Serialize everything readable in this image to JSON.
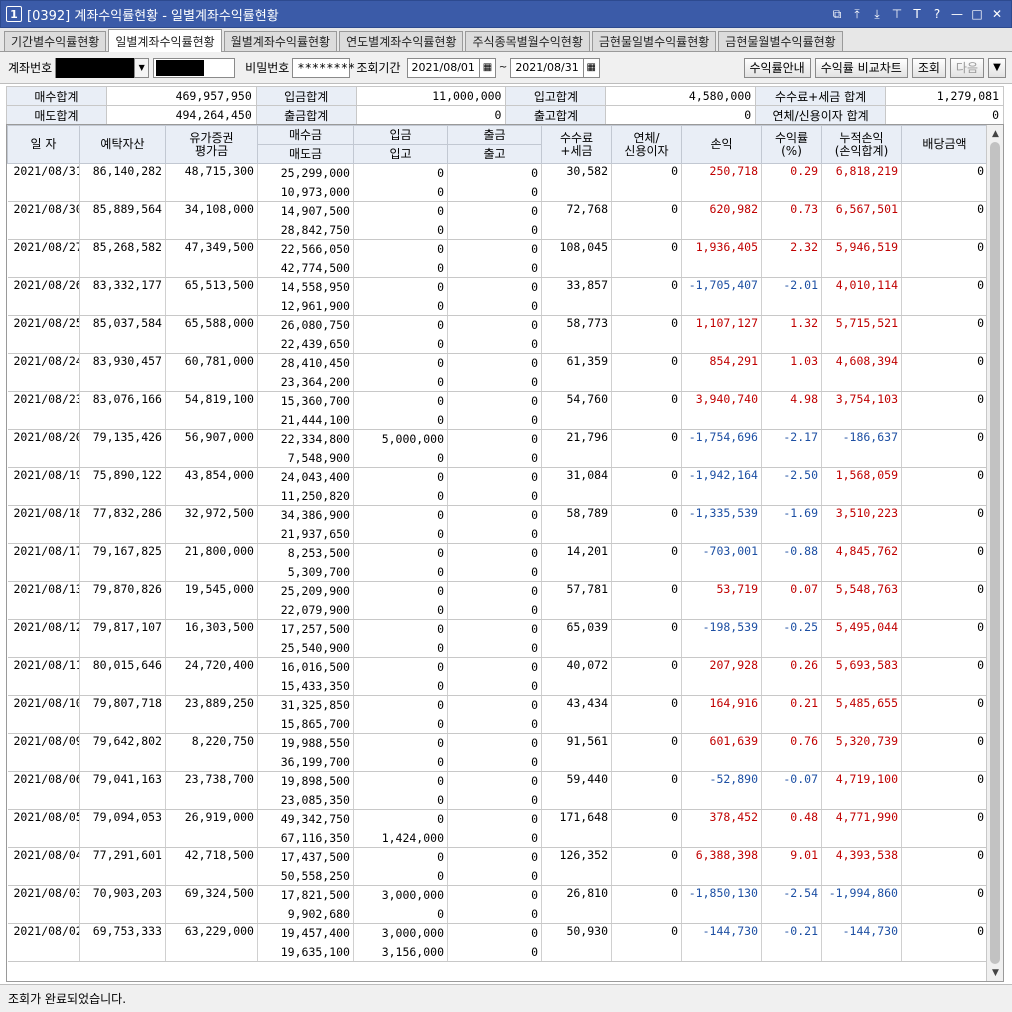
{
  "window": {
    "num": "1",
    "title": "[0392] 계좌수익률현황 - 일별계좌수익률현황",
    "controls": [
      "⧉",
      "⤒",
      "⤓",
      "⊤",
      "T",
      "?",
      "—",
      "□",
      "✕"
    ]
  },
  "tabs": [
    {
      "label": "기간별수익률현황",
      "active": false
    },
    {
      "label": "일별계좌수익률현황",
      "active": true
    },
    {
      "label": "월별계좌수익률현황",
      "active": false
    },
    {
      "label": "연도별계좌수익률현황",
      "active": false
    },
    {
      "label": "주식종목별월수익현황",
      "active": false
    },
    {
      "label": "금현물일별수익률현황",
      "active": false
    },
    {
      "label": "금현물월별수익률현황",
      "active": false
    }
  ],
  "toolbar": {
    "account_label": "계좌번호",
    "password_label": "비밀번호",
    "password_value": "********",
    "period_label": "조회기간",
    "date_from": "2021/08/01",
    "date_to": "2021/08/31",
    "tilde": "~",
    "btn_guide": "수익률안내",
    "btn_compare": "수익률 비교차트",
    "btn_query": "조회",
    "btn_next": "다음"
  },
  "summary": {
    "rows": [
      [
        {
          "h": "매수합계",
          "v": "469,957,950"
        },
        {
          "h": "입금합계",
          "v": "11,000,000"
        },
        {
          "h": "입고합계",
          "v": "4,580,000"
        },
        {
          "h": "수수료+세금 합계",
          "v": "1,279,081"
        }
      ],
      [
        {
          "h": "매도합계",
          "v": "494,264,450"
        },
        {
          "h": "출금합계",
          "v": "0"
        },
        {
          "h": "출고합계",
          "v": "0"
        },
        {
          "h": "연체/신용이자 합계",
          "v": "0"
        }
      ]
    ]
  },
  "grid": {
    "headers": {
      "date": "일 자",
      "deposit": "예탁자산",
      "securities": "유가증권\n평가금",
      "buy": "매수금",
      "sell": "매도금",
      "in_money": "입금",
      "in_stock": "입고",
      "out_money": "출금",
      "out_stock": "출고",
      "fee": "수수료\n+세금",
      "interest": "연체/\n신용이자",
      "pnl": "손익",
      "rate": "수익률\n(%)",
      "cum": "누적손익\n(손익합계)",
      "dividend": "배당금액"
    },
    "rows": [
      {
        "date": "2021/08/31",
        "deposit": "86,140,282",
        "sec": "48,715,300",
        "buy": "25,299,000",
        "sell": "10,973,000",
        "in1": "0",
        "in2": "0",
        "out1": "0",
        "out2": "0",
        "fee": "30,582",
        "int": "0",
        "pnl": "250,718",
        "rate": "0.29",
        "cum": "6,818,219",
        "div": "0"
      },
      {
        "date": "2021/08/30",
        "deposit": "85,889,564",
        "sec": "34,108,000",
        "buy": "14,907,500",
        "sell": "28,842,750",
        "in1": "0",
        "in2": "0",
        "out1": "0",
        "out2": "0",
        "fee": "72,768",
        "int": "0",
        "pnl": "620,982",
        "rate": "0.73",
        "cum": "6,567,501",
        "div": "0"
      },
      {
        "date": "2021/08/27",
        "deposit": "85,268,582",
        "sec": "47,349,500",
        "buy": "22,566,050",
        "sell": "42,774,500",
        "in1": "0",
        "in2": "0",
        "out1": "0",
        "out2": "0",
        "fee": "108,045",
        "int": "0",
        "pnl": "1,936,405",
        "rate": "2.32",
        "cum": "5,946,519",
        "div": "0"
      },
      {
        "date": "2021/08/26",
        "deposit": "83,332,177",
        "sec": "65,513,500",
        "buy": "14,558,950",
        "sell": "12,961,900",
        "in1": "0",
        "in2": "0",
        "out1": "0",
        "out2": "0",
        "fee": "33,857",
        "int": "0",
        "pnl": "-1,705,407",
        "rate": "-2.01",
        "cum": "4,010,114",
        "div": "0"
      },
      {
        "date": "2021/08/25",
        "deposit": "85,037,584",
        "sec": "65,588,000",
        "buy": "26,080,750",
        "sell": "22,439,650",
        "in1": "0",
        "in2": "0",
        "out1": "0",
        "out2": "0",
        "fee": "58,773",
        "int": "0",
        "pnl": "1,107,127",
        "rate": "1.32",
        "cum": "5,715,521",
        "div": "0"
      },
      {
        "date": "2021/08/24",
        "deposit": "83,930,457",
        "sec": "60,781,000",
        "buy": "28,410,450",
        "sell": "23,364,200",
        "in1": "0",
        "in2": "0",
        "out1": "0",
        "out2": "0",
        "fee": "61,359",
        "int": "0",
        "pnl": "854,291",
        "rate": "1.03",
        "cum": "4,608,394",
        "div": "0"
      },
      {
        "date": "2021/08/23",
        "deposit": "83,076,166",
        "sec": "54,819,100",
        "buy": "15,360,700",
        "sell": "21,444,100",
        "in1": "0",
        "in2": "0",
        "out1": "0",
        "out2": "0",
        "fee": "54,760",
        "int": "0",
        "pnl": "3,940,740",
        "rate": "4.98",
        "cum": "3,754,103",
        "div": "0"
      },
      {
        "date": "2021/08/20",
        "deposit": "79,135,426",
        "sec": "56,907,000",
        "buy": "22,334,800",
        "sell": "7,548,900",
        "in1": "5,000,000",
        "in2": "0",
        "out1": "0",
        "out2": "0",
        "fee": "21,796",
        "int": "0",
        "pnl": "-1,754,696",
        "rate": "-2.17",
        "cum": "-186,637",
        "div": "0"
      },
      {
        "date": "2021/08/19",
        "deposit": "75,890,122",
        "sec": "43,854,000",
        "buy": "24,043,400",
        "sell": "11,250,820",
        "in1": "0",
        "in2": "0",
        "out1": "0",
        "out2": "0",
        "fee": "31,084",
        "int": "0",
        "pnl": "-1,942,164",
        "rate": "-2.50",
        "cum": "1,568,059",
        "div": "0"
      },
      {
        "date": "2021/08/18",
        "deposit": "77,832,286",
        "sec": "32,972,500",
        "buy": "34,386,900",
        "sell": "21,937,650",
        "in1": "0",
        "in2": "0",
        "out1": "0",
        "out2": "0",
        "fee": "58,789",
        "int": "0",
        "pnl": "-1,335,539",
        "rate": "-1.69",
        "cum": "3,510,223",
        "div": "0"
      },
      {
        "date": "2021/08/17",
        "deposit": "79,167,825",
        "sec": "21,800,000",
        "buy": "8,253,500",
        "sell": "5,309,700",
        "in1": "0",
        "in2": "0",
        "out1": "0",
        "out2": "0",
        "fee": "14,201",
        "int": "0",
        "pnl": "-703,001",
        "rate": "-0.88",
        "cum": "4,845,762",
        "div": "0"
      },
      {
        "date": "2021/08/13",
        "deposit": "79,870,826",
        "sec": "19,545,000",
        "buy": "25,209,900",
        "sell": "22,079,900",
        "in1": "0",
        "in2": "0",
        "out1": "0",
        "out2": "0",
        "fee": "57,781",
        "int": "0",
        "pnl": "53,719",
        "rate": "0.07",
        "cum": "5,548,763",
        "div": "0"
      },
      {
        "date": "2021/08/12",
        "deposit": "79,817,107",
        "sec": "16,303,500",
        "buy": "17,257,500",
        "sell": "25,540,900",
        "in1": "0",
        "in2": "0",
        "out1": "0",
        "out2": "0",
        "fee": "65,039",
        "int": "0",
        "pnl": "-198,539",
        "rate": "-0.25",
        "cum": "5,495,044",
        "div": "0"
      },
      {
        "date": "2021/08/11",
        "deposit": "80,015,646",
        "sec": "24,720,400",
        "buy": "16,016,500",
        "sell": "15,433,350",
        "in1": "0",
        "in2": "0",
        "out1": "0",
        "out2": "0",
        "fee": "40,072",
        "int": "0",
        "pnl": "207,928",
        "rate": "0.26",
        "cum": "5,693,583",
        "div": "0"
      },
      {
        "date": "2021/08/10",
        "deposit": "79,807,718",
        "sec": "23,889,250",
        "buy": "31,325,850",
        "sell": "15,865,700",
        "in1": "0",
        "in2": "0",
        "out1": "0",
        "out2": "0",
        "fee": "43,434",
        "int": "0",
        "pnl": "164,916",
        "rate": "0.21",
        "cum": "5,485,655",
        "div": "0"
      },
      {
        "date": "2021/08/09",
        "deposit": "79,642,802",
        "sec": "8,220,750",
        "buy": "19,988,550",
        "sell": "36,199,700",
        "in1": "0",
        "in2": "0",
        "out1": "0",
        "out2": "0",
        "fee": "91,561",
        "int": "0",
        "pnl": "601,639",
        "rate": "0.76",
        "cum": "5,320,739",
        "div": "0"
      },
      {
        "date": "2021/08/06",
        "deposit": "79,041,163",
        "sec": "23,738,700",
        "buy": "19,898,500",
        "sell": "23,085,350",
        "in1": "0",
        "in2": "0",
        "out1": "0",
        "out2": "0",
        "fee": "59,440",
        "int": "0",
        "pnl": "-52,890",
        "rate": "-0.07",
        "cum": "4,719,100",
        "div": "0"
      },
      {
        "date": "2021/08/05",
        "deposit": "79,094,053",
        "sec": "26,919,000",
        "buy": "49,342,750",
        "sell": "67,116,350",
        "in1": "0",
        "in2": "1,424,000",
        "out1": "0",
        "out2": "0",
        "fee": "171,648",
        "int": "0",
        "pnl": "378,452",
        "rate": "0.48",
        "cum": "4,771,990",
        "div": "0"
      },
      {
        "date": "2021/08/04",
        "deposit": "77,291,601",
        "sec": "42,718,500",
        "buy": "17,437,500",
        "sell": "50,558,250",
        "in1": "0",
        "in2": "0",
        "out1": "0",
        "out2": "0",
        "fee": "126,352",
        "int": "0",
        "pnl": "6,388,398",
        "rate": "9.01",
        "cum": "4,393,538",
        "div": "0"
      },
      {
        "date": "2021/08/03",
        "deposit": "70,903,203",
        "sec": "69,324,500",
        "buy": "17,821,500",
        "sell": "9,902,680",
        "in1": "3,000,000",
        "in2": "0",
        "out1": "0",
        "out2": "0",
        "fee": "26,810",
        "int": "0",
        "pnl": "-1,850,130",
        "rate": "-2.54",
        "cum": "-1,994,860",
        "div": "0"
      },
      {
        "date": "2021/08/02",
        "deposit": "69,753,333",
        "sec": "63,229,000",
        "buy": "19,457,400",
        "sell": "19,635,100",
        "in1": "3,000,000",
        "in2": "3,156,000",
        "out1": "0",
        "out2": "0",
        "fee": "50,930",
        "int": "0",
        "pnl": "-144,730",
        "rate": "-0.21",
        "cum": "-144,730",
        "div": "0"
      }
    ]
  },
  "status": "조회가 완료되었습니다.",
  "colors": {
    "positive": "#c00000",
    "negative": "#1d4fa3",
    "title_bar": "#3b5ba8"
  }
}
